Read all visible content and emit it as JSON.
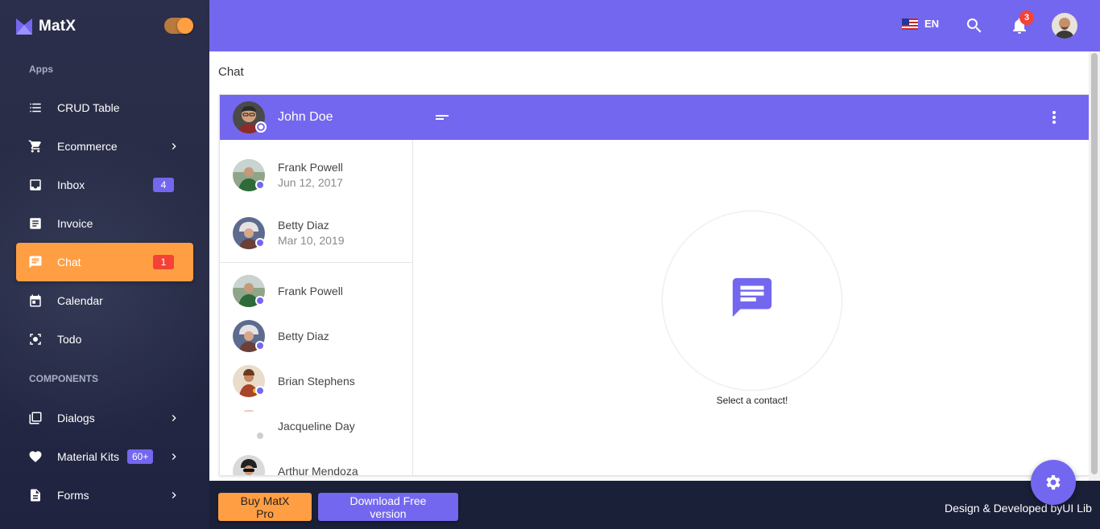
{
  "brand": {
    "name": "MatX"
  },
  "sidebar": {
    "sections": [
      {
        "label": "Apps"
      },
      {
        "label": "COMPONENTS"
      }
    ],
    "items": [
      {
        "label": "CRUD Table",
        "icon": "list-icon"
      },
      {
        "label": "Ecommerce",
        "icon": "cart-icon"
      },
      {
        "label": "Inbox",
        "icon": "inbox-icon",
        "badge": "4"
      },
      {
        "label": "Invoice",
        "icon": "invoice-icon"
      },
      {
        "label": "Chat",
        "icon": "chat-icon",
        "badge": "1",
        "active": true
      },
      {
        "label": "Calendar",
        "icon": "calendar-icon"
      },
      {
        "label": "Todo",
        "icon": "todo-icon"
      },
      {
        "label": "Dialogs",
        "icon": "dialogs-icon"
      },
      {
        "label": "Material Kits",
        "icon": "heart-icon",
        "badge": "60+"
      },
      {
        "label": "Forms",
        "icon": "forms-icon"
      }
    ]
  },
  "topbar": {
    "language": "EN",
    "notification_count": "3"
  },
  "page": {
    "title": "Chat"
  },
  "chat": {
    "current_user": {
      "name": "John Doe"
    },
    "recent": [
      {
        "name": "Frank Powell",
        "date": "Jun 12, 2017",
        "status": "online"
      },
      {
        "name": "Betty Diaz",
        "date": "Mar 10, 2019",
        "status": "online"
      }
    ],
    "contacts": [
      {
        "name": "Frank Powell",
        "status": "online"
      },
      {
        "name": "Betty Diaz",
        "status": "online"
      },
      {
        "name": "Brian Stephens",
        "status": "online"
      },
      {
        "name": "Jacqueline Day",
        "status": "offline"
      },
      {
        "name": "Arthur Mendoza",
        "status": "online"
      }
    ],
    "empty_state": "Select a contact!"
  },
  "footer": {
    "buy_label": "Buy MatX Pro",
    "download_label": "Download Free version",
    "credit": "Design & Developed byUI Lib"
  },
  "colors": {
    "primary": "#7467ef",
    "accent": "#ff9e43",
    "sidebar_bg": "#272b45",
    "footer_bg": "#1a2038",
    "badge_red": "#f44336"
  }
}
